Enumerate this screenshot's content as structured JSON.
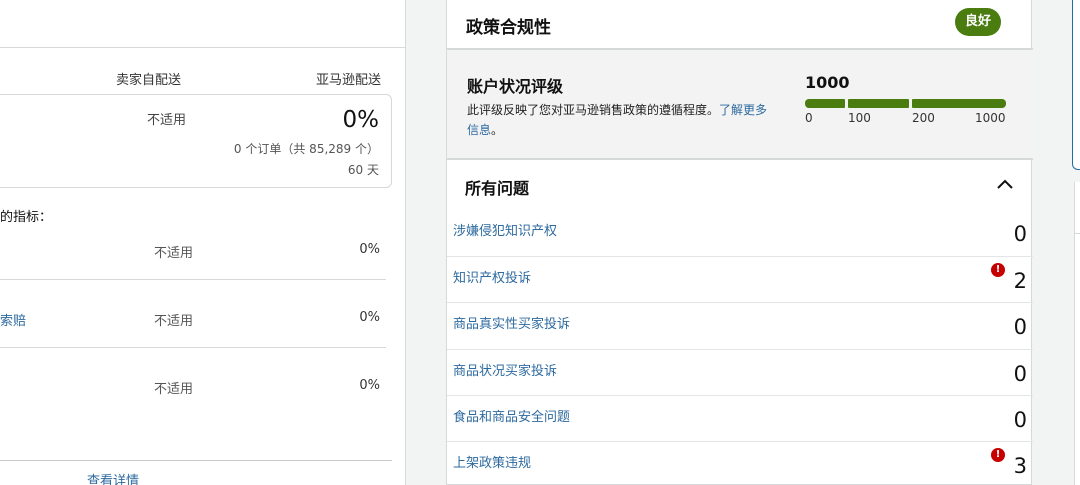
{
  "left": {
    "col_mfn": "卖家自配送",
    "col_afn": "亚马逊配送",
    "metric": {
      "na": "不适用",
      "percent": "0%",
      "orders": "0 个订单（共 85,289 个）",
      "days": "60 天"
    },
    "sub_label": "的指标：",
    "rows": [
      {
        "name": "",
        "na": "不适用",
        "percent": "0%"
      },
      {
        "name": "索赔",
        "na": "不适用",
        "percent": "0%"
      },
      {
        "name": "",
        "na": "不适用",
        "percent": "0%"
      }
    ],
    "view_details": "查看详情"
  },
  "policy": {
    "title": "政策合规性",
    "badge": "良好",
    "badge_color": "#4a7c0f",
    "rating": {
      "title": "账户状况评级",
      "desc": "此评级反映了您对亚马逊销售政策的遵循程度。",
      "link": "了解更多信息",
      "period": "。",
      "value": "1000",
      "ticks": [
        "0",
        "100",
        "200",
        "1000"
      ]
    },
    "issues_title": "所有问题",
    "collapse_icon": "chevron-up-icon",
    "issues": [
      {
        "name": "涉嫌侵犯知识产权",
        "count": "0",
        "alert": false
      },
      {
        "name": "知识产权投诉",
        "count": "2",
        "alert": true
      },
      {
        "name": "商品真实性买家投诉",
        "count": "0",
        "alert": false
      },
      {
        "name": "商品状况买家投诉",
        "count": "0",
        "alert": false
      },
      {
        "name": "食品和商品安全问题",
        "count": "0",
        "alert": false
      },
      {
        "name": "上架政策违规",
        "count": "3",
        "alert": true
      }
    ],
    "alert_icon_glyph": "!",
    "alert_color": "#c40000"
  }
}
